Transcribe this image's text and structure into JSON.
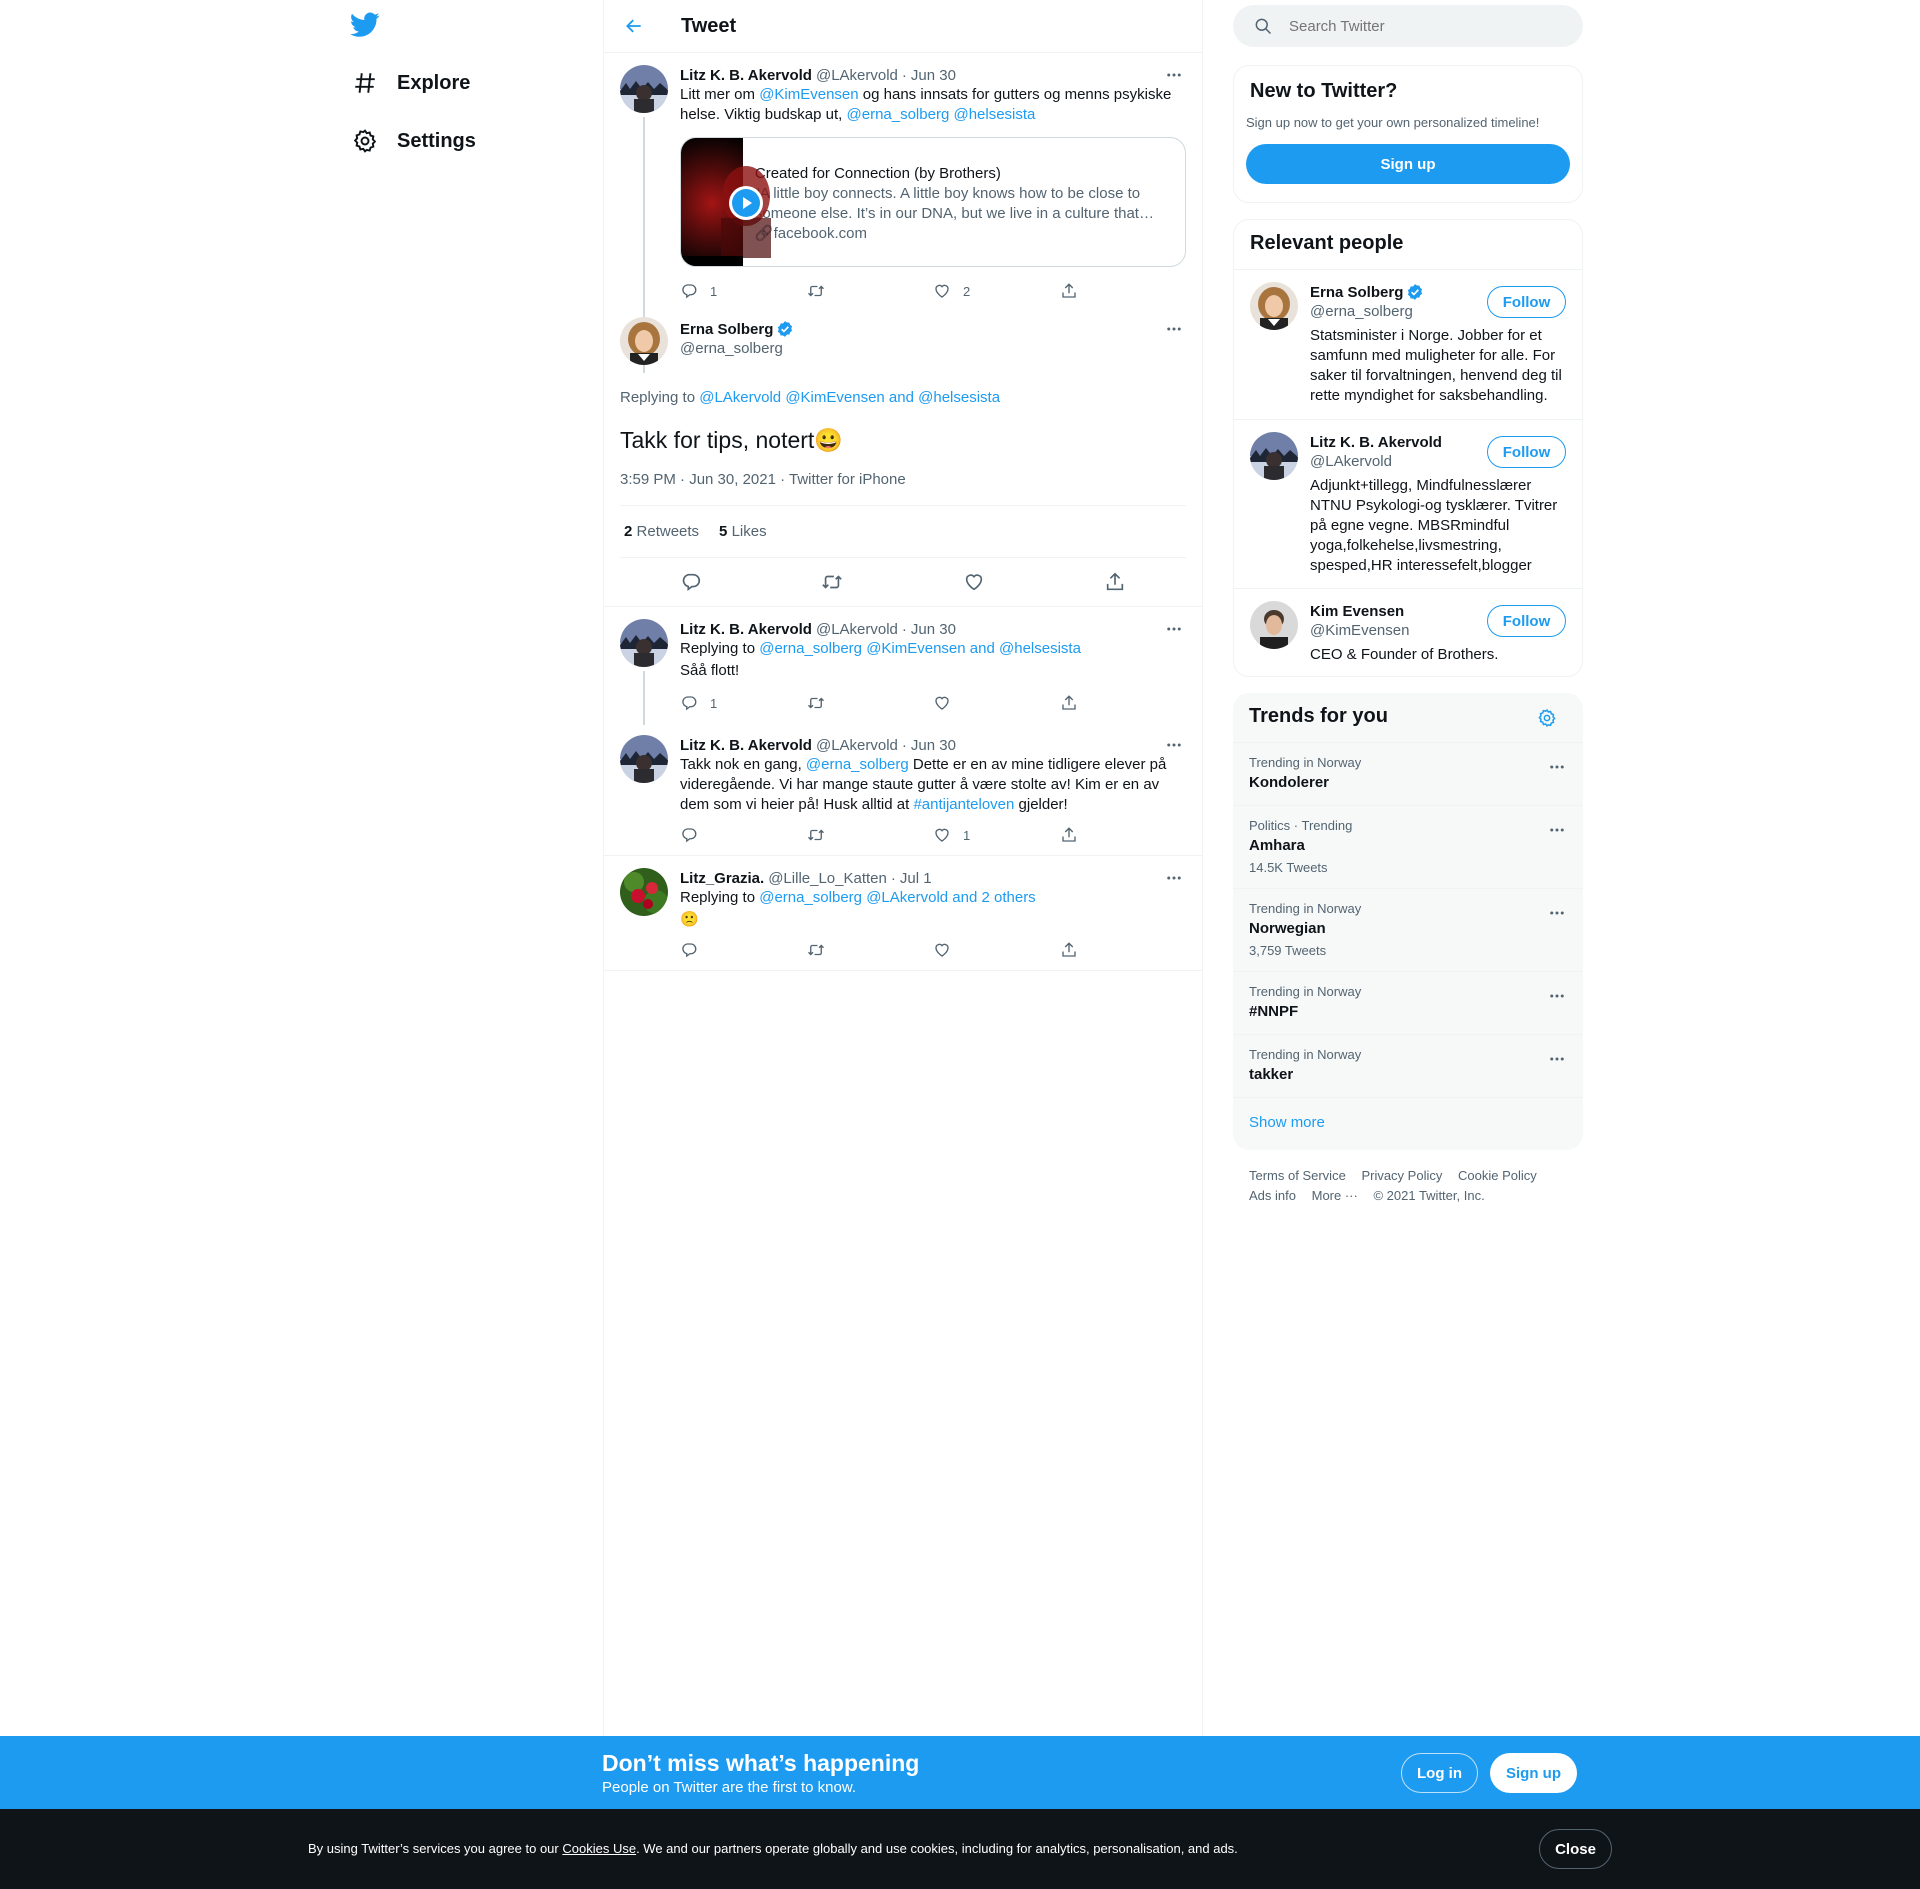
{
  "nav": {
    "logo": "twitter-bird-icon",
    "items": [
      {
        "label": "Explore",
        "icon": "hashtag-icon"
      },
      {
        "label": "Settings",
        "icon": "gear-icon"
      }
    ]
  },
  "header": {
    "title": "Tweet"
  },
  "parent_tweet": {
    "name": "Litz K. B. Akervold",
    "handle": "@LAkervold",
    "dot": "·",
    "date": "Jun 30",
    "text_parts": [
      "Litt mer om ",
      "@KimEvensen",
      " og hans innsats for gutters og menns psykiske helse. Viktig budskap ut, ",
      "@erna_solberg",
      " ",
      "@helsesista"
    ],
    "card": {
      "title": "Created for Connection (by Brothers)",
      "description": "“A little boy connects. A little boy knows how to be close to someone else. It’s in our DNA, but we live in a culture that teaches boys...",
      "domain": "facebook.com"
    },
    "replies": "1",
    "retweets": "",
    "likes": "2"
  },
  "focused_tweet": {
    "name": "Erna Solberg",
    "handle": "@erna_solberg",
    "replying_label": "Replying to ",
    "replying_to": [
      "@LAkervold",
      "@KimEvensen",
      " and ",
      "@helsesista"
    ],
    "text": "Takk for tips, notert",
    "emoji": "😀",
    "meta": "3:59 PM · Jun 30, 2021 · Twitter for iPhone",
    "retweets_count": "2",
    "retweets_label": "Retweets",
    "likes_count": "5",
    "likes_label": "Likes"
  },
  "replies": [
    {
      "name": "Litz K. B. Akervold",
      "handle": "@LAkervold",
      "dot": "·",
      "date": "Jun 30",
      "replying_label": "Replying to ",
      "replying_to": [
        "@erna_solberg",
        "@KimEvensen",
        " and ",
        "@helsesista"
      ],
      "text": "Såå flott!",
      "replies": "1",
      "likes": ""
    },
    {
      "name": "Litz K. B. Akervold",
      "handle": "@LAkervold",
      "dot": "·",
      "date": "Jun 30",
      "text_parts": [
        "Takk nok en gang, ",
        "@erna_solberg",
        " Dette er en av mine tidligere elever på videregående. Vi har mange staute gutter å være stolte av! Kim er en av dem som vi heier på! Husk alltid at ",
        "#antijanteloven",
        " gjelder!"
      ],
      "replies": "",
      "likes": "1"
    },
    {
      "name": "Litz_Grazia.",
      "handle": "@Lille_Lo_Katten",
      "dot": "·",
      "date": "Jul 1",
      "replying_label": "Replying to ",
      "replying_to": [
        "@erna_solberg",
        "@LAkervold",
        " and 2 others"
      ],
      "text": "🙁",
      "replies": "",
      "likes": ""
    }
  ],
  "search": {
    "placeholder": "Search Twitter"
  },
  "new_to_twitter": {
    "title": "New to Twitter?",
    "subtitle": "Sign up now to get your own personalized timeline!",
    "button": "Sign up"
  },
  "relevant_people": {
    "title": "Relevant people",
    "follow_label": "Follow",
    "people": [
      {
        "name": "Erna Solberg",
        "handle": "@erna_solberg",
        "verified": true,
        "bio": "Statsminister i Norge. Jobber for et samfunn med muligheter for alle. For saker til forvaltningen, henvend deg til rette myndighet for saksbehandling."
      },
      {
        "name": "Litz K. B. Akervold",
        "handle": "@LAkervold",
        "verified": false,
        "bio": "Adjunkt+tillegg, Mindfulnesslærer NTNU Psykologi-og tysklærer. Tvitrer på egne vegne. MBSRmindful yoga,folkehelse,livsmestring, spesped,HR interessefelt,blogger"
      },
      {
        "name": "Kim Evensen",
        "handle": "@KimEvensen",
        "verified": false,
        "bio": "CEO & Founder of Brothers."
      }
    ]
  },
  "trends": {
    "title": "Trends for you",
    "items": [
      {
        "context": "Trending in Norway",
        "name": "Kondolerer",
        "count": ""
      },
      {
        "context": "Politics · Trending",
        "name": "Amhara",
        "count": "14.5K Tweets"
      },
      {
        "context": "Trending in Norway",
        "name": "Norwegian",
        "count": "3,759 Tweets"
      },
      {
        "context": "Trending in Norway",
        "name": "#NNPF",
        "count": ""
      },
      {
        "context": "Trending in Norway",
        "name": "takker",
        "count": ""
      }
    ],
    "show_more": "Show more"
  },
  "footer": {
    "links": [
      "Terms of Service",
      "Privacy Policy",
      "Cookie Policy",
      "Ads info",
      "More ···"
    ],
    "copyright": "© 2021 Twitter, Inc."
  },
  "signup_bar": {
    "title": "Don’t miss what’s happening",
    "subtitle": "People on Twitter are the first to know.",
    "login": "Log in",
    "signup": "Sign up"
  },
  "cookie_bar": {
    "text_before": "By using Twitter’s services you agree to our ",
    "link": "Cookies Use",
    "text_after": ". We and our partners operate globally and use cookies, including for analytics, personalisation, and ads.",
    "close": "Close"
  },
  "colors": {
    "accent": "#1d9bf0",
    "text": "#0f1419",
    "muted": "#536471",
    "border": "#eff3f4",
    "dark_bar": "#0f1419"
  }
}
